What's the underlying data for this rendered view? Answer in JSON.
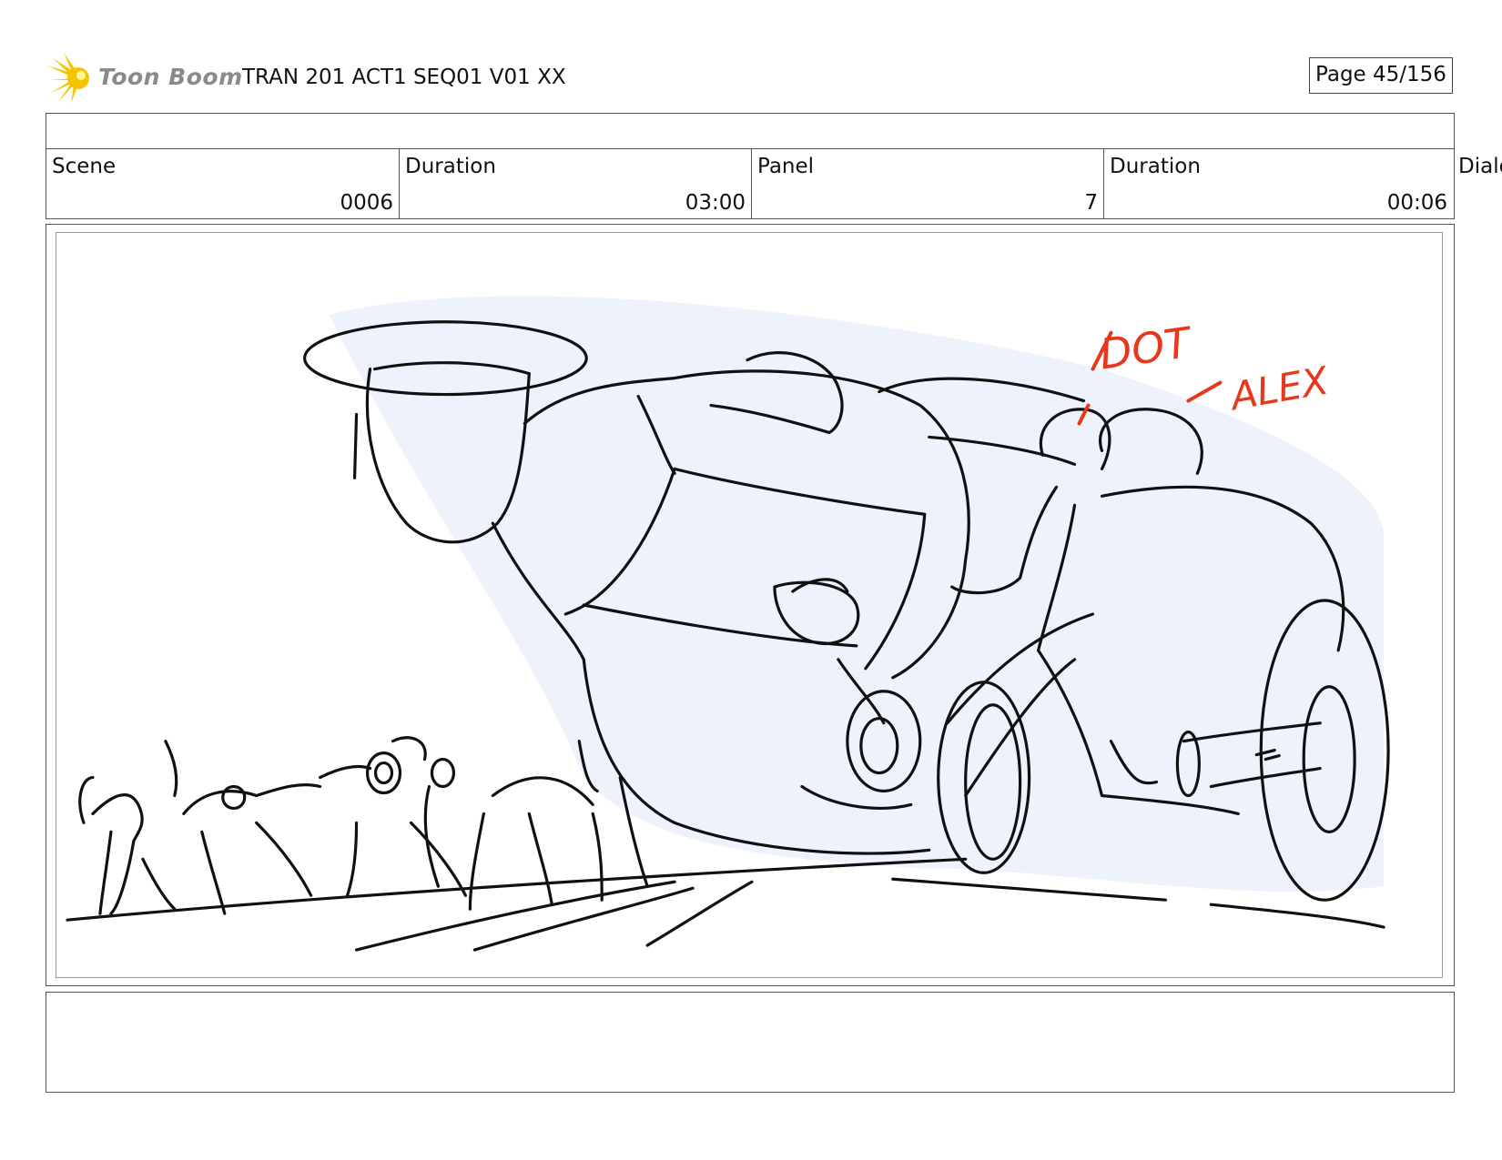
{
  "header": {
    "logo_text": "Toon Boom",
    "doc_title": "TRAN 201 ACT1 SEQ01 V01 XX",
    "page": "Page  45/156"
  },
  "info": {
    "scene_label": "Scene",
    "scene_value": "0006",
    "scene_duration_label": "Duration",
    "scene_duration_value": "03:00",
    "panel_label": "Panel",
    "panel_value": "7",
    "panel_duration_label": "Duration",
    "panel_duration_value": "00:06",
    "dialog_label": "Dialo"
  },
  "sketch": {
    "annotation_dot": "DOT",
    "annotation_alex": "ALEX"
  },
  "colors": {
    "logo_yellow": "#f5c400",
    "annotation_red": "#e8381c",
    "ink": "#111111"
  }
}
